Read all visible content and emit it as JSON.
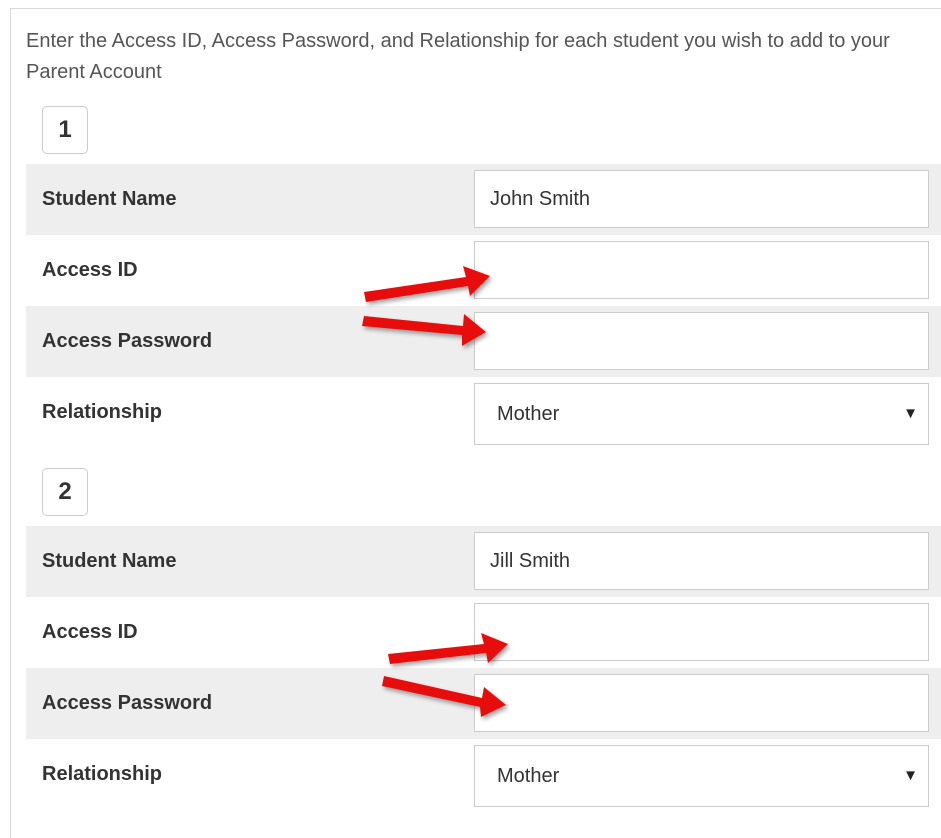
{
  "intro_text": "Enter the Access ID, Access Password, and Relationship for each student you wish to add to your Parent Account",
  "students": [
    {
      "number": "1",
      "student_name_label": "Student Name",
      "student_name_value": "John Smith",
      "access_id_label": "Access ID",
      "access_id_value": "",
      "access_password_label": "Access Password",
      "access_password_value": "",
      "relationship_label": "Relationship",
      "relationship_value": "Mother"
    },
    {
      "number": "2",
      "student_name_label": "Student Name",
      "student_name_value": "Jill Smith",
      "access_id_label": "Access ID",
      "access_id_value": "",
      "access_password_label": "Access Password",
      "access_password_value": "",
      "relationship_label": "Relationship",
      "relationship_value": "Mother"
    }
  ],
  "icons": {
    "dropdown_caret": "▼",
    "annotation": "red-arrow-icon"
  },
  "colors": {
    "row_shade": "#eeeeee",
    "border": "#cccccc",
    "annotation_arrow": "#e8100c"
  }
}
